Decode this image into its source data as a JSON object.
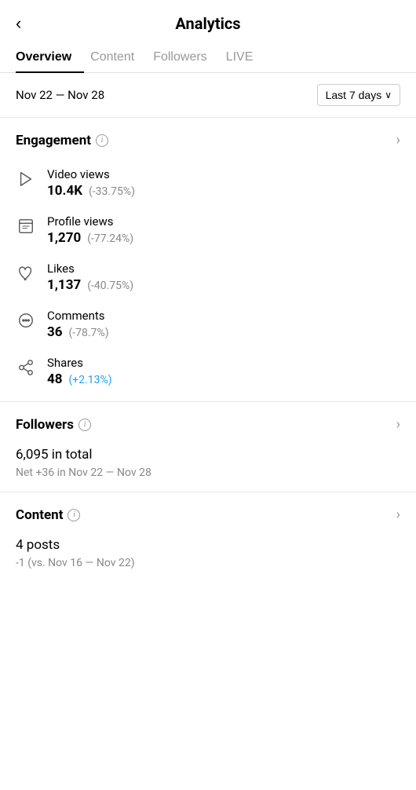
{
  "header": {
    "back_label": "‹",
    "title": "Analytics"
  },
  "tabs": [
    {
      "label": "Overview",
      "active": true
    },
    {
      "label": "Content",
      "active": false
    },
    {
      "label": "Followers",
      "active": false
    },
    {
      "label": "LIVE",
      "active": false
    }
  ],
  "date_bar": {
    "range": "Nov 22 — Nov 28",
    "dropdown_label": "Last 7 days",
    "dropdown_arrow": "∨"
  },
  "engagement": {
    "section_title": "Engagement",
    "info_label": "i",
    "chevron": "›",
    "metrics": [
      {
        "id": "video-views",
        "label": "Video views",
        "value": "10.4K",
        "change": "(-33.75%)",
        "positive": false,
        "icon": "play"
      },
      {
        "id": "profile-views",
        "label": "Profile views",
        "value": "1,270",
        "change": "(-77.24%)",
        "positive": false,
        "icon": "profile"
      },
      {
        "id": "likes",
        "label": "Likes",
        "value": "1,137",
        "change": "(-40.75%)",
        "positive": false,
        "icon": "heart"
      },
      {
        "id": "comments",
        "label": "Comments",
        "value": "36",
        "change": "(-78.7%)",
        "positive": false,
        "icon": "comment"
      },
      {
        "id": "shares",
        "label": "Shares",
        "value": "48",
        "change": "(+2.13%)",
        "positive": true,
        "icon": "share"
      }
    ]
  },
  "followers": {
    "section_title": "Followers",
    "info_label": "i",
    "chevron": "›",
    "total": "6,095",
    "total_suffix": " in total",
    "net": "Net +36 in Nov 22 — Nov 28"
  },
  "content": {
    "section_title": "Content",
    "info_label": "i",
    "chevron": "›",
    "posts": "4",
    "posts_suffix": " posts",
    "comparison": "-1 (vs. Nov 16 — Nov 22)"
  }
}
